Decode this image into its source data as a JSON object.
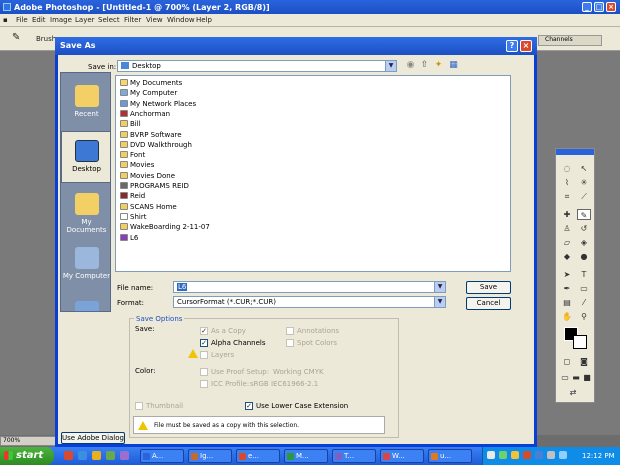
{
  "photoshop": {
    "title": "Adobe Photoshop - [Untitled-1 @ 700% (Layer 2, RGB/8)]",
    "menu": [
      "File",
      "Edit",
      "Image",
      "Layer",
      "Select",
      "Filter",
      "View",
      "Window",
      "Help"
    ],
    "options_bar": {
      "brush_label": "Brush:"
    },
    "channels_tab": "Channels",
    "zoom": "700%"
  },
  "dialog": {
    "title": "Save As",
    "save_in_label": "Save in:",
    "save_in_value": "Desktop",
    "places": [
      "Recent",
      "Desktop",
      "My Documents",
      "My Computer"
    ],
    "files": [
      {
        "name": "My Documents",
        "icon": "my-documents-icon",
        "color": "#f5d76a"
      },
      {
        "name": "My Computer",
        "icon": "computer-icon",
        "color": "#7fa9d9"
      },
      {
        "name": "My Network Places",
        "icon": "network-places-icon",
        "color": "#6d9ad6"
      },
      {
        "name": "Anchorman",
        "icon": "program-icon",
        "color": "#b33030"
      },
      {
        "name": "Bill",
        "icon": "folder-icon",
        "color": "#f1cf5e"
      },
      {
        "name": "BVRP Software",
        "icon": "folder-icon",
        "color": "#f1cf5e"
      },
      {
        "name": "DVD Walkthrough",
        "icon": "folder-icon",
        "color": "#f1cf5e"
      },
      {
        "name": "Font",
        "icon": "folder-icon",
        "color": "#f1cf5e"
      },
      {
        "name": "Movies",
        "icon": "folder-icon",
        "color": "#f1cf5e"
      },
      {
        "name": "Movies Done",
        "icon": "folder-icon",
        "color": "#f1cf5e"
      },
      {
        "name": "PROGRAMS REID",
        "icon": "program-icon",
        "color": "#6a6a6a"
      },
      {
        "name": "Reid",
        "icon": "program-icon",
        "color": "#8b2a2a"
      },
      {
        "name": "SCANS Home",
        "icon": "folder-icon",
        "color": "#f1cf5e"
      },
      {
        "name": "Shirt",
        "icon": "cursor-icon",
        "color": "#ffffff"
      },
      {
        "name": "WakeBoarding 2-11-07",
        "icon": "folder-icon",
        "color": "#f1cf5e"
      },
      {
        "name": "L6",
        "icon": "program-icon",
        "color": "#8a3fb5"
      }
    ],
    "file_name_label": "File name:",
    "file_name_value": "L6",
    "format_label": "Format:",
    "format_value": "CursorFormat (*.CUR;*.CUR)",
    "save_button": "Save",
    "cancel_button": "Cancel",
    "save_options": {
      "legend": "Save Options",
      "save_label": "Save:",
      "as_a_copy": "As a Copy",
      "alpha_channels": "Alpha Channels",
      "layers": "Layers",
      "annotations": "Annotations",
      "spot_colors": "Spot Colors",
      "color_label": "Color:",
      "use_proof_setup": "Use Proof Setup:",
      "proof_value": "Working CMYK",
      "icc_profile": "ICC Profile:",
      "icc_value": "sRGB IEC61966-2.1",
      "thumbnail": "Thumbnail",
      "use_lower_case": "Use Lower Case Extension",
      "warning": "File must be saved as a copy with this selection."
    },
    "use_adobe_dialog": "Use Adobe Dialog"
  },
  "taskbar": {
    "start": "start",
    "tasks": [
      {
        "label": "A...",
        "color": "#2a64dc"
      },
      {
        "label": "Ig...",
        "color": "#c66a2a"
      },
      {
        "label": "e...",
        "color": "#d94a2a"
      },
      {
        "label": "M...",
        "color": "#2a9a3a"
      },
      {
        "label": "T...",
        "color": "#7f5fbf"
      },
      {
        "label": "W...",
        "color": "#d44"
      },
      {
        "label": "u...",
        "color": "#e07a20"
      }
    ],
    "clock": "12:12 PM"
  }
}
